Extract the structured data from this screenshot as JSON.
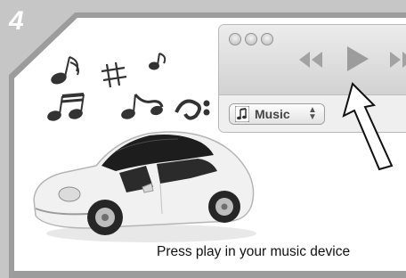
{
  "step": {
    "number": "4"
  },
  "player": {
    "source_label": "Music",
    "source_stepper": "⌃⌄",
    "controls": [
      "previous-icon",
      "play-icon",
      "next-icon"
    ],
    "window_buttons": [
      "close",
      "minimize",
      "zoom"
    ]
  },
  "caption": {
    "text": "Press play in your music device"
  },
  "colors": {
    "frame_gray": "#c8c8c8",
    "window_bg": "#e6e6e6",
    "control_gray": "#9a9a9a",
    "car_body": "#f2f2f2",
    "car_top": "#222222",
    "note_color": "#333333"
  }
}
